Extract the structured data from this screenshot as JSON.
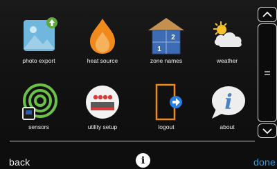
{
  "tiles": [
    {
      "label": "photo export",
      "icon": "photo-export-icon"
    },
    {
      "label": "heat source",
      "icon": "flame-icon"
    },
    {
      "label": "zone names",
      "icon": "house-zones-icon"
    },
    {
      "label": "weather",
      "icon": "weather-sun-cloud-icon"
    },
    {
      "label": "sensors",
      "icon": "sensors-signal-icon"
    },
    {
      "label": "utility setup",
      "icon": "utility-meter-icon"
    },
    {
      "label": "logout",
      "icon": "logout-door-icon"
    },
    {
      "label": "about",
      "icon": "about-info-bubble-icon"
    }
  ],
  "zone_icon": {
    "zone1": "1",
    "zone2": "2"
  },
  "about_icon_letter": "i",
  "scroll": {
    "up_icon": "chevron-up-icon",
    "handle_icon": "scroll-handle-icon",
    "down_icon": "chevron-down-icon"
  },
  "footer": {
    "back_label": "back",
    "info_label": "i",
    "done_label": "done"
  },
  "colors": {
    "done": "#2f9be5",
    "photo_bg": "#6fb7dc",
    "upload_badge": "#5ea83c",
    "flame_outer": "#f08a1c",
    "flame_inner": "#f6b15d",
    "house_roof": "#c4904f",
    "house_body": "#3d6bb4",
    "sun": "#f4c12a",
    "sensor_green": "#6cc04a",
    "meter_body": "#f2f2f2",
    "meter_red": "#d93b3b",
    "door": "#f08a1c",
    "arrow": "#2a7de1",
    "speech_text": "#4a82c3"
  }
}
